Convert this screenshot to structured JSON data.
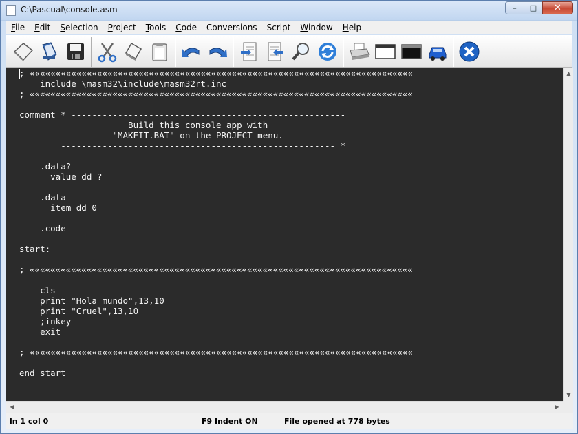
{
  "window": {
    "title": "C:\\Pascual\\console.asm",
    "buttons": {
      "minimize": "–",
      "maximize": "□",
      "close": "✕"
    }
  },
  "menu": [
    {
      "underline": "F",
      "rest": "ile"
    },
    {
      "underline": "E",
      "rest": "dit"
    },
    {
      "underline": "S",
      "rest": "election"
    },
    {
      "underline": "P",
      "rest": "roject"
    },
    {
      "underline": "T",
      "rest": "ools"
    },
    {
      "underline": "C",
      "rest": "ode"
    },
    {
      "underline": "",
      "rest": "Conversions"
    },
    {
      "underline": "S",
      "rest": "cript",
      "prefix": "",
      "alt": true
    },
    {
      "underline": "W",
      "rest": "indow"
    },
    {
      "underline": "H",
      "rest": "elp"
    }
  ],
  "toolbar": {
    "icons": [
      "new-file-icon",
      "open-file-icon",
      "save-icon",
      "cut-icon",
      "copy-icon",
      "paste-icon",
      "undo-icon",
      "redo-icon",
      "indent-icon",
      "outdent-icon",
      "find-icon",
      "refresh-icon",
      "print-icon",
      "window-icon",
      "console-icon",
      "car-icon",
      "exit-icon"
    ]
  },
  "editor": {
    "lines": [
      "; ««««««««««««««««««««««««««««««««««««««««««««««««««««««««««««««««««««««««««",
      "    include \\masm32\\include\\masm32rt.inc",
      "; ««««««««««««««««««««««««««««««««««««««««««««««««««««««««««««««««««««««««««",
      "",
      "comment * -----------------------------------------------------",
      "                     Build this console app with",
      "                  \"MAKEIT.BAT\" on the PROJECT menu.",
      "        ----------------------------------------------------- *",
      "",
      "    .data?",
      "      value dd ?",
      "",
      "    .data",
      "      item dd 0",
      "",
      "    .code",
      "",
      "start:",
      "",
      "; ««««««««««««««««««««««««««««««««««««««««««««««««««««««««««««««««««««««««««",
      "",
      "    cls",
      "    print \"Hola mundo\",13,10",
      "    print \"Cruel\",13,10",
      "    ;inkey",
      "    exit",
      "",
      "; ««««««««««««««««««««««««««««««««««««««««««««««««««««««««««««««««««««««««««",
      "",
      "end start"
    ]
  },
  "status": {
    "position": "ln 1 col 0",
    "indent": "F9 Indent ON",
    "message": "File opened at 778 bytes"
  },
  "colors": {
    "editor_bg": "#2b2b2b",
    "editor_fg": "#f4f4f4"
  }
}
